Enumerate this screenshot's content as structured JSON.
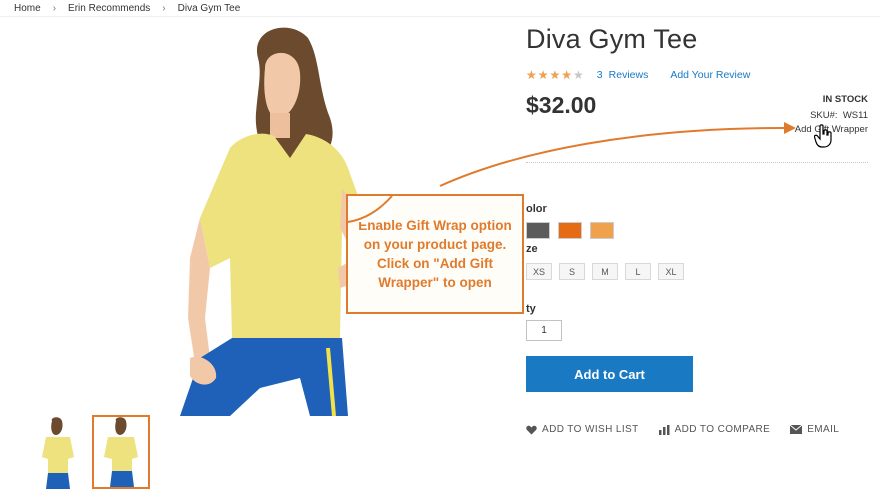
{
  "breadcrumb": {
    "items": [
      "Home",
      "Erin Recommends",
      "Diva Gym Tee"
    ]
  },
  "product": {
    "title": "Diva Gym Tee",
    "rating_fraction": 0.8,
    "reviews_count": "3",
    "reviews_label": "Reviews",
    "add_review_label": "Add Your Review",
    "price": "$32.00",
    "stock_status": "IN STOCK",
    "sku_label": "SKU#:",
    "sku_value": "WS11",
    "gift_wrapper_label": "Add Gift Wrapper"
  },
  "options": {
    "color_label": "olor",
    "colors": [
      "#5b5b5b",
      "#e56b15",
      "#f0a14b"
    ],
    "size_label": "ze",
    "sizes": [
      "XS",
      "S",
      "M",
      "L",
      "XL"
    ],
    "qty_label": "ty",
    "qty_value": "1"
  },
  "cart": {
    "add_to_cart_label": "Add to Cart"
  },
  "actions": {
    "wishlist_label": "ADD TO WISH LIST",
    "compare_label": "ADD TO COMPARE",
    "email_label": "EMAIL"
  },
  "callout": {
    "text": "Enable Gift Wrap option on your product page. Click on \"Add Gift Wrapper\" to open"
  },
  "colors": {
    "accent_blue": "#1979c3",
    "callout_orange": "#e07b2e",
    "star": "#f0a14b"
  }
}
